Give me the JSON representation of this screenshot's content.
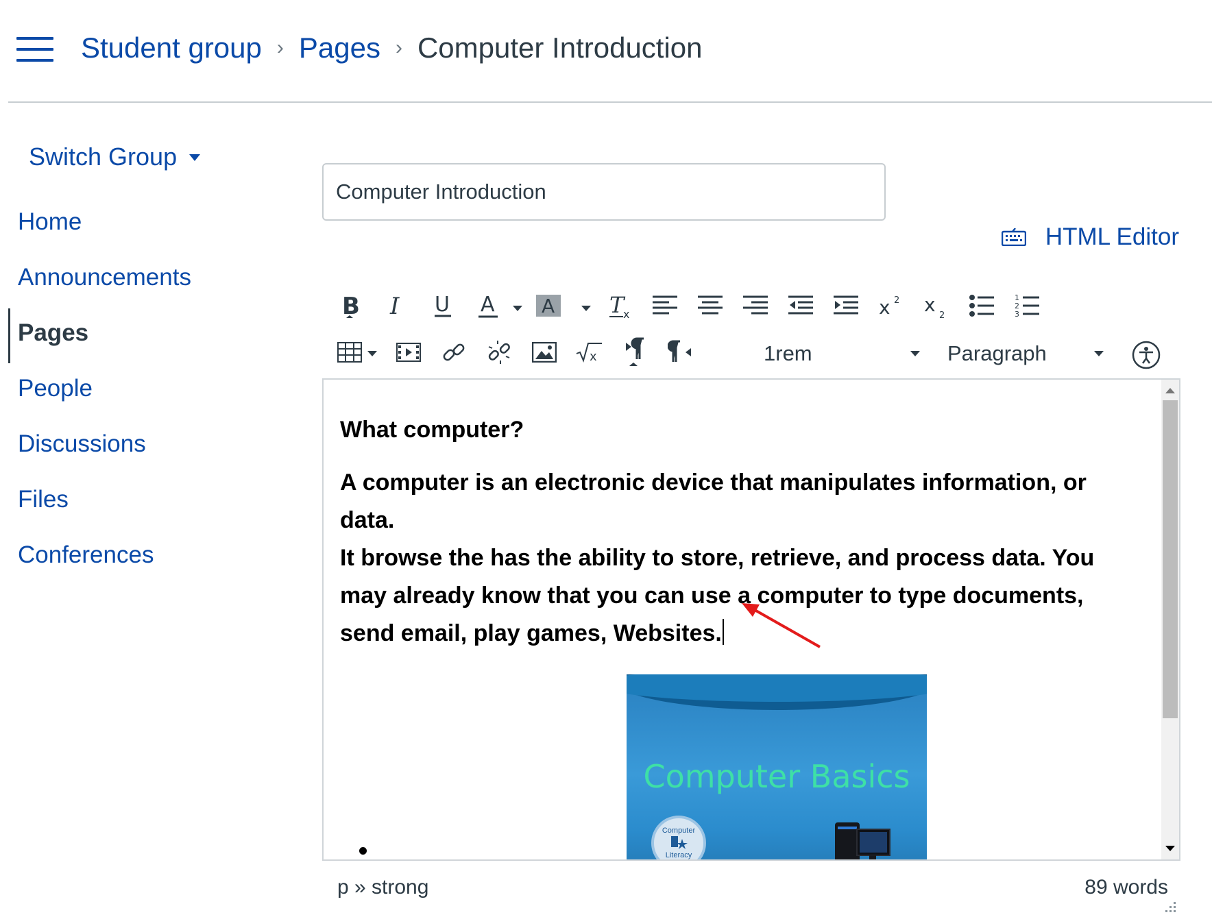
{
  "breadcrumb": {
    "items": [
      {
        "label": "Student group"
      },
      {
        "label": "Pages"
      },
      {
        "label": "Computer Introduction"
      }
    ],
    "separator": "›"
  },
  "sidebar": {
    "switch_group_label": "Switch Group",
    "items": [
      {
        "label": "Home",
        "active": false
      },
      {
        "label": "Announcements",
        "active": false
      },
      {
        "label": "Pages",
        "active": true
      },
      {
        "label": "People",
        "active": false
      },
      {
        "label": "Discussions",
        "active": false
      },
      {
        "label": "Files",
        "active": false
      },
      {
        "label": "Conferences",
        "active": false
      }
    ]
  },
  "page_title_input": {
    "value": "Computer Introduction"
  },
  "html_editor_label": "HTML Editor",
  "toolbar": {
    "font_size": "1rem",
    "block_format": "Paragraph",
    "icons": [
      "bold-icon",
      "italic-icon",
      "underline-icon",
      "text-color-icon",
      "highlight-color-icon",
      "clear-formatting-icon",
      "align-left-icon",
      "align-center-icon",
      "align-right-icon",
      "outdent-icon",
      "indent-icon",
      "superscript-icon",
      "subscript-icon",
      "bullet-list-icon",
      "numbered-list-icon",
      "table-icon",
      "media-icon",
      "link-icon",
      "unlink-icon",
      "image-icon",
      "equation-icon",
      "ltr-icon",
      "rtl-icon",
      "accessibility-icon"
    ]
  },
  "content": {
    "heading": "What computer?",
    "paragraph_line1": "A computer is an electronic device that manipulates information, or data.",
    "paragraph_line2": "It browse the  has the ability to store, retrieve, and process data. You",
    "paragraph_line3": "may already know that you can use a computer to type documents,",
    "paragraph_line4": "send email, play games, Websites.",
    "image": {
      "title": "Computer Basics",
      "seal_top": "Computer",
      "seal_bottom": "Literacy"
    }
  },
  "status": {
    "path": "p » strong",
    "word_count": "89 words"
  },
  "colors": {
    "link": "#0b4aa8",
    "text": "#2d3b45",
    "annotation_arrow": "#e31b1b"
  }
}
